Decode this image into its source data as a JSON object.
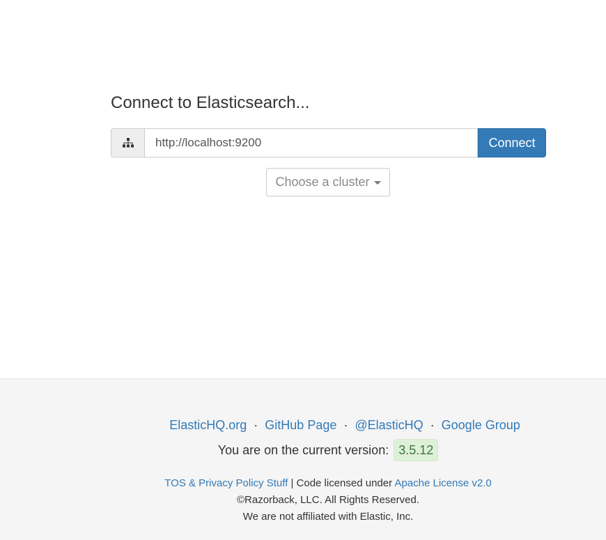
{
  "main": {
    "title": "Connect to Elasticsearch...",
    "addon_icon": "sitemap-icon",
    "url_value": "http://localhost:9200",
    "connect_label": "Connect",
    "cluster_label": "Choose a cluster"
  },
  "footer": {
    "links": {
      "elastichq_org": "ElasticHQ.org",
      "github": "GitHub Page",
      "twitter": "@ElasticHQ",
      "google_group": "Google Group",
      "separator": "·"
    },
    "version_text": "You are on the current version:",
    "version_number": "3.5.12",
    "tos_link": "TOS & Privacy Policy Stuff",
    "license_text": " | Code licensed under ",
    "license_link": "Apache License v2.0",
    "copyright": "©Razorback, LLC. All Rights Reserved.",
    "disclaimer": "We are not affiliated with Elastic, Inc."
  },
  "colors": {
    "primary": "#337ab7",
    "version_bg": "#dff0d8",
    "footer_bg": "#f5f5f5"
  }
}
